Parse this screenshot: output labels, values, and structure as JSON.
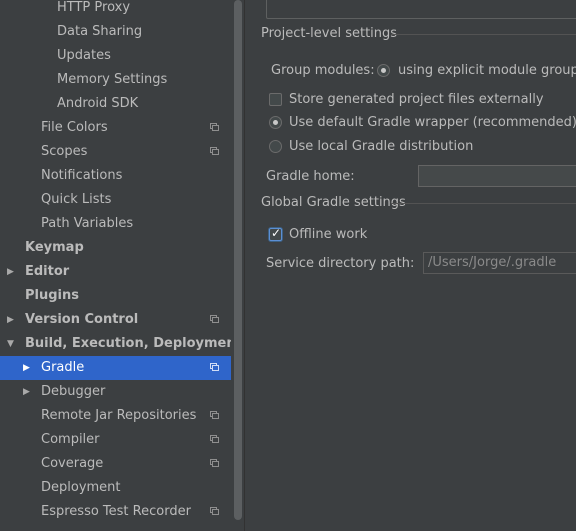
{
  "sidebar": {
    "items": [
      {
        "label": "HTTP Proxy"
      },
      {
        "label": "Data Sharing"
      },
      {
        "label": "Updates"
      },
      {
        "label": "Memory Settings"
      },
      {
        "label": "Android SDK"
      },
      {
        "label": "File Colors"
      },
      {
        "label": "Scopes"
      },
      {
        "label": "Notifications"
      },
      {
        "label": "Quick Lists"
      },
      {
        "label": "Path Variables"
      },
      {
        "label": "Keymap"
      },
      {
        "label": "Editor"
      },
      {
        "label": "Plugins"
      },
      {
        "label": "Version Control"
      },
      {
        "label": "Build, Execution, Deployment"
      },
      {
        "label": "Gradle"
      },
      {
        "label": "Debugger"
      },
      {
        "label": "Remote Jar Repositories"
      },
      {
        "label": "Compiler"
      },
      {
        "label": "Coverage"
      },
      {
        "label": "Deployment"
      },
      {
        "label": "Espresso Test Recorder"
      }
    ],
    "selected": "Gradle"
  },
  "project_settings": {
    "header": "Project-level settings",
    "group_modules_label": "Group modules:",
    "group_modules_option": "using explicit module groups",
    "store_externally_label": "Store generated project files externally",
    "store_externally_checked": false,
    "default_wrapper_label": "Use default Gradle wrapper (recommended)",
    "local_distribution_label": "Use local Gradle distribution",
    "selected_distribution": "default",
    "gradle_home_label": "Gradle home:",
    "gradle_home_value": ""
  },
  "global_settings": {
    "header": "Global Gradle settings",
    "offline_work_label": "Offline work",
    "offline_work_checked": true,
    "service_dir_label": "Service directory path:",
    "service_dir_value": "/Users/Jorge/.gradle"
  },
  "colors": {
    "background": "#3c3f41",
    "selection": "#2f65ca",
    "text": "#bbbbbb"
  }
}
